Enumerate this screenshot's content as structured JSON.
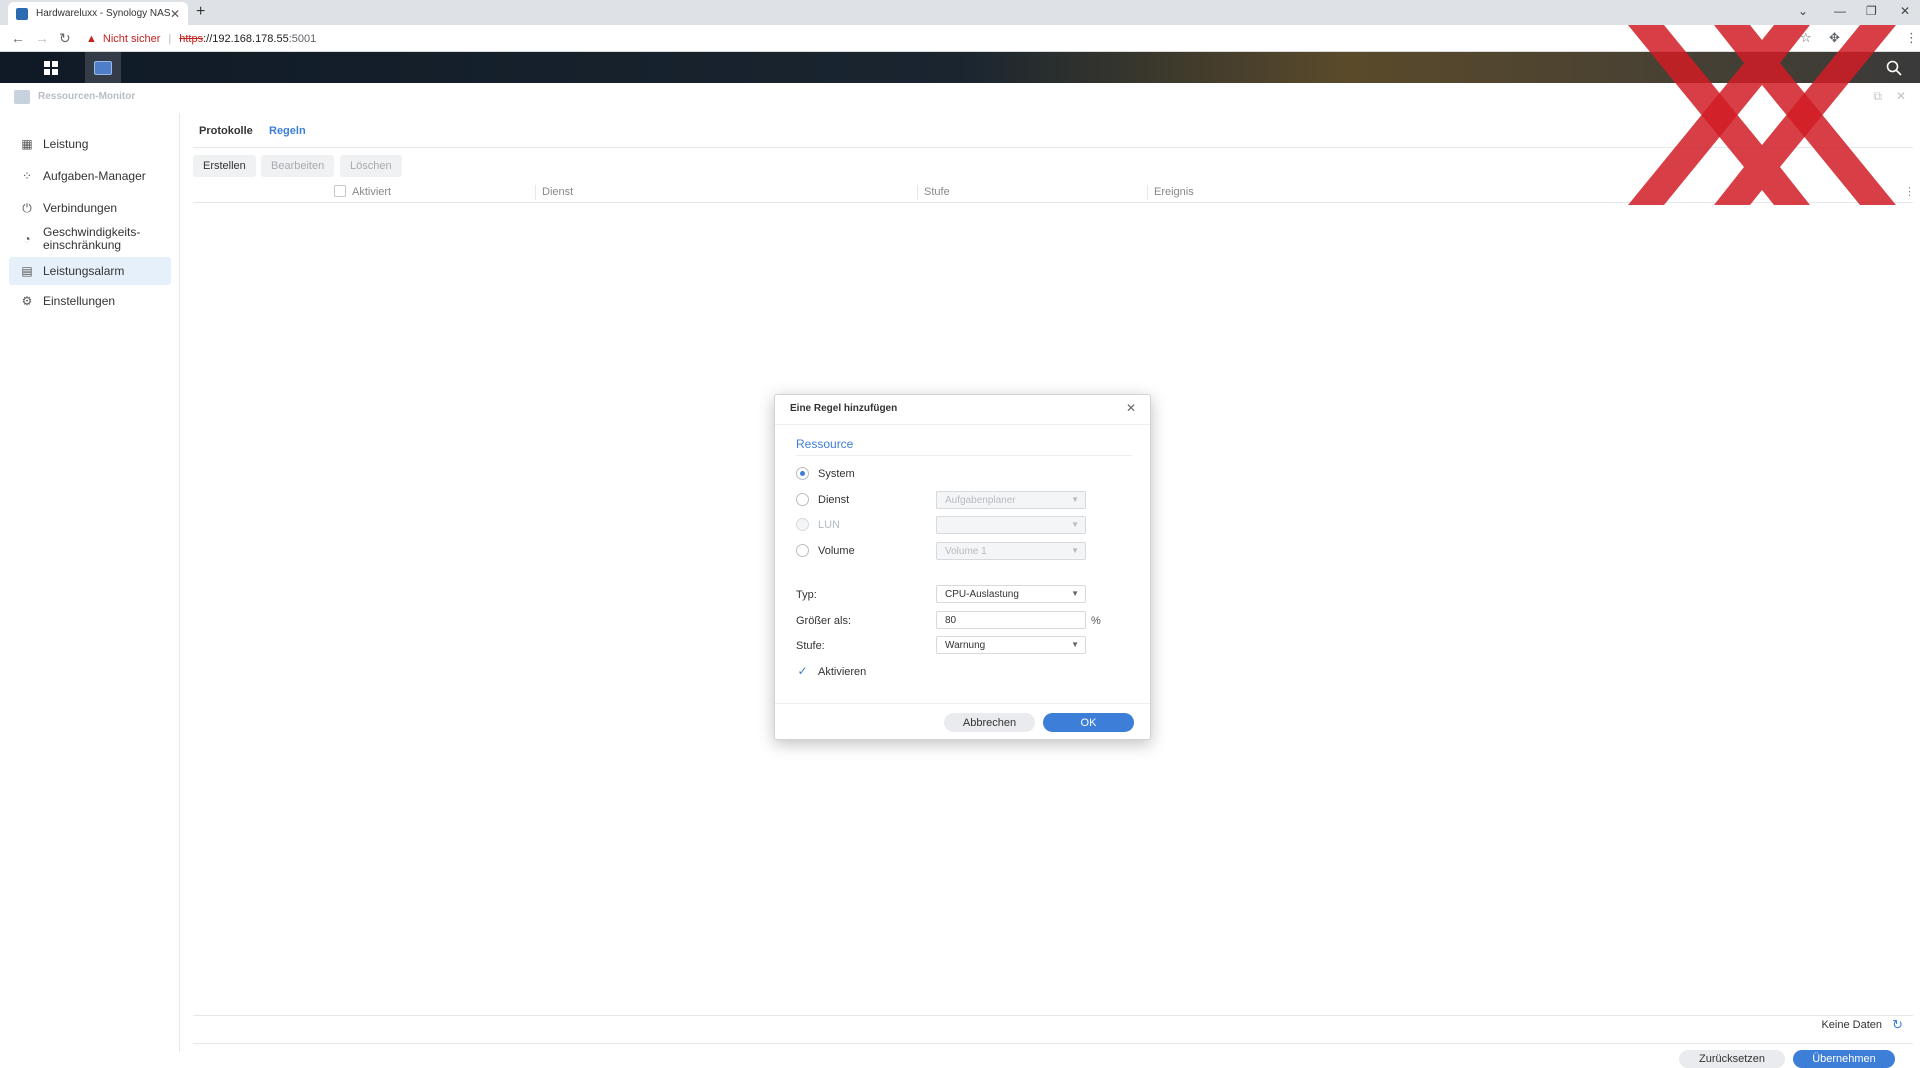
{
  "browser": {
    "tab_title": "Hardwareluxx - Synology NAS",
    "new_tab": "+",
    "security_text": "Nicht sicher",
    "url_scheme": "https",
    "url_host": "://192.168.178.55",
    "url_port": ":5001"
  },
  "app": {
    "title": "Ressourcen-Monitor",
    "sidebar": {
      "items": [
        {
          "label": "Leistung",
          "icon": "chart-icon"
        },
        {
          "label": "Aufgaben-Manager",
          "icon": "tasks-icon"
        },
        {
          "label": "Verbindungen",
          "icon": "plug-icon"
        },
        {
          "label": "Geschwindigkeits-",
          "label2": "einschränkung",
          "icon": "speedometer-icon"
        },
        {
          "label": "Leistungsalarm",
          "icon": "document-icon"
        },
        {
          "label": "Einstellungen",
          "icon": "gear-icon"
        }
      ],
      "active_index": 4
    },
    "tabs": [
      "Protokolle",
      "Regeln"
    ],
    "active_tab": "Regeln",
    "toolbar": {
      "create": "Erstellen",
      "edit": "Bearbeiten",
      "delete": "Löschen"
    },
    "table": {
      "columns": [
        "Aktiviert",
        "Dienst",
        "Stufe",
        "Ereignis"
      ]
    },
    "status": "Keine Daten",
    "footer": {
      "reset": "Zurücksetzen",
      "apply": "Übernehmen"
    }
  },
  "dialog": {
    "title": "Eine Regel hinzufügen",
    "section": "Ressource",
    "options": [
      {
        "label": "System",
        "checked": true,
        "disabled": false
      },
      {
        "label": "Dienst",
        "checked": false,
        "disabled": false,
        "select_value": "Aufgabenplaner"
      },
      {
        "label": "LUN",
        "checked": false,
        "disabled": true,
        "select_value": ""
      },
      {
        "label": "Volume",
        "checked": false,
        "disabled": false,
        "select_value": "Volume 1"
      }
    ],
    "type_label": "Typ:",
    "type_value": "CPU-Auslastung",
    "greater_label": "Größer als:",
    "greater_value": "80",
    "unit": "%",
    "level_label": "Stufe:",
    "level_value": "Warnung",
    "enable_label": "Aktivieren",
    "enable_checked": true,
    "cancel": "Abbrechen",
    "ok": "OK"
  },
  "colors": {
    "accent": "#3d7ed8",
    "watermark": "#d11c24"
  }
}
